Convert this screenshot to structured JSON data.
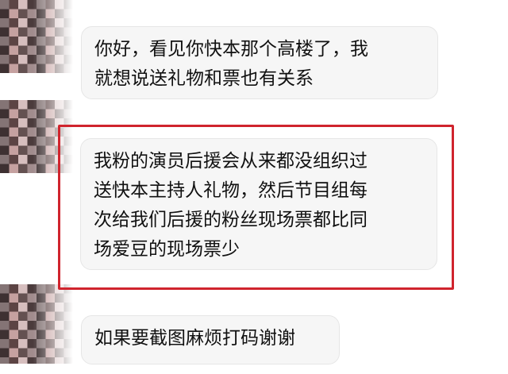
{
  "messages": [
    {
      "text": "你好，看见你快本那个高楼了，我\n就想说送礼物和票也有关系"
    },
    {
      "text": "我粉的演员后援会从来都没组织过\n送快本主持人礼物，然后节目组每\n次给我们后援的粉丝现场票都比同\n场爱豆的现场票少"
    },
    {
      "text": "如果要截图麻烦打码谢谢"
    }
  ],
  "colors": {
    "bubble": "#f6f6f6",
    "highlight": "#d0242d",
    "text": "#111111"
  }
}
